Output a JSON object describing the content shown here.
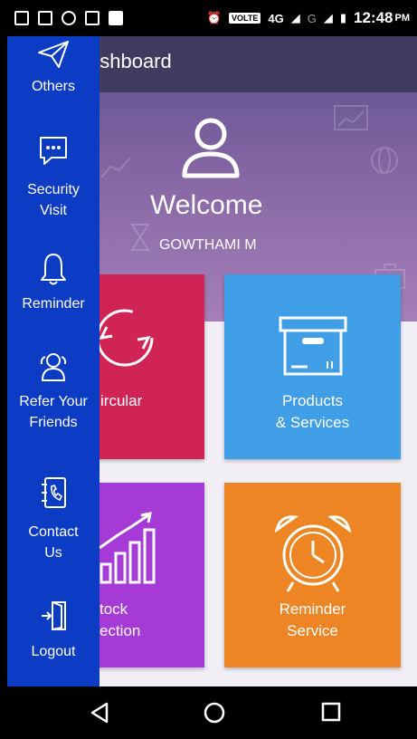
{
  "status_bar": {
    "volte": "VOLTE",
    "network": "4G",
    "network2": "G",
    "time": "12:48",
    "ampm": "PM"
  },
  "app_bar": {
    "title": "ashboard"
  },
  "header": {
    "welcome": "Welcome",
    "user_name": "GOWTHAMI M"
  },
  "tiles": [
    {
      "label": "ircular",
      "color": "#d02554"
    },
    {
      "label_line1": "Products",
      "label_line2": "& Services",
      "color": "#3f9ee6"
    },
    {
      "label_line1": "tock",
      "label_line2": "ection",
      "color": "#a63ad6"
    },
    {
      "label_line1": "Reminder",
      "label_line2": "Service",
      "color": "#ee8525"
    }
  ],
  "drawer": {
    "color": "#0d3cc4",
    "items": [
      {
        "label_line1": "Others",
        "icon": "paper-plane-icon"
      },
      {
        "label_line1": "Security",
        "label_line2": "Visit",
        "icon": "chat-bubble-icon"
      },
      {
        "label_line1": "Reminder",
        "icon": "bell-icon"
      },
      {
        "label_line1": "Refer Your",
        "label_line2": "Friends",
        "icon": "users-icon"
      },
      {
        "label_line1": "Contact",
        "label_line2": "Us",
        "icon": "phone-book-icon"
      },
      {
        "label_line1": "Logout",
        "icon": "door-exit-icon"
      }
    ]
  },
  "nav": {
    "back": "back-icon",
    "home": "home-icon",
    "recents": "recents-icon"
  }
}
